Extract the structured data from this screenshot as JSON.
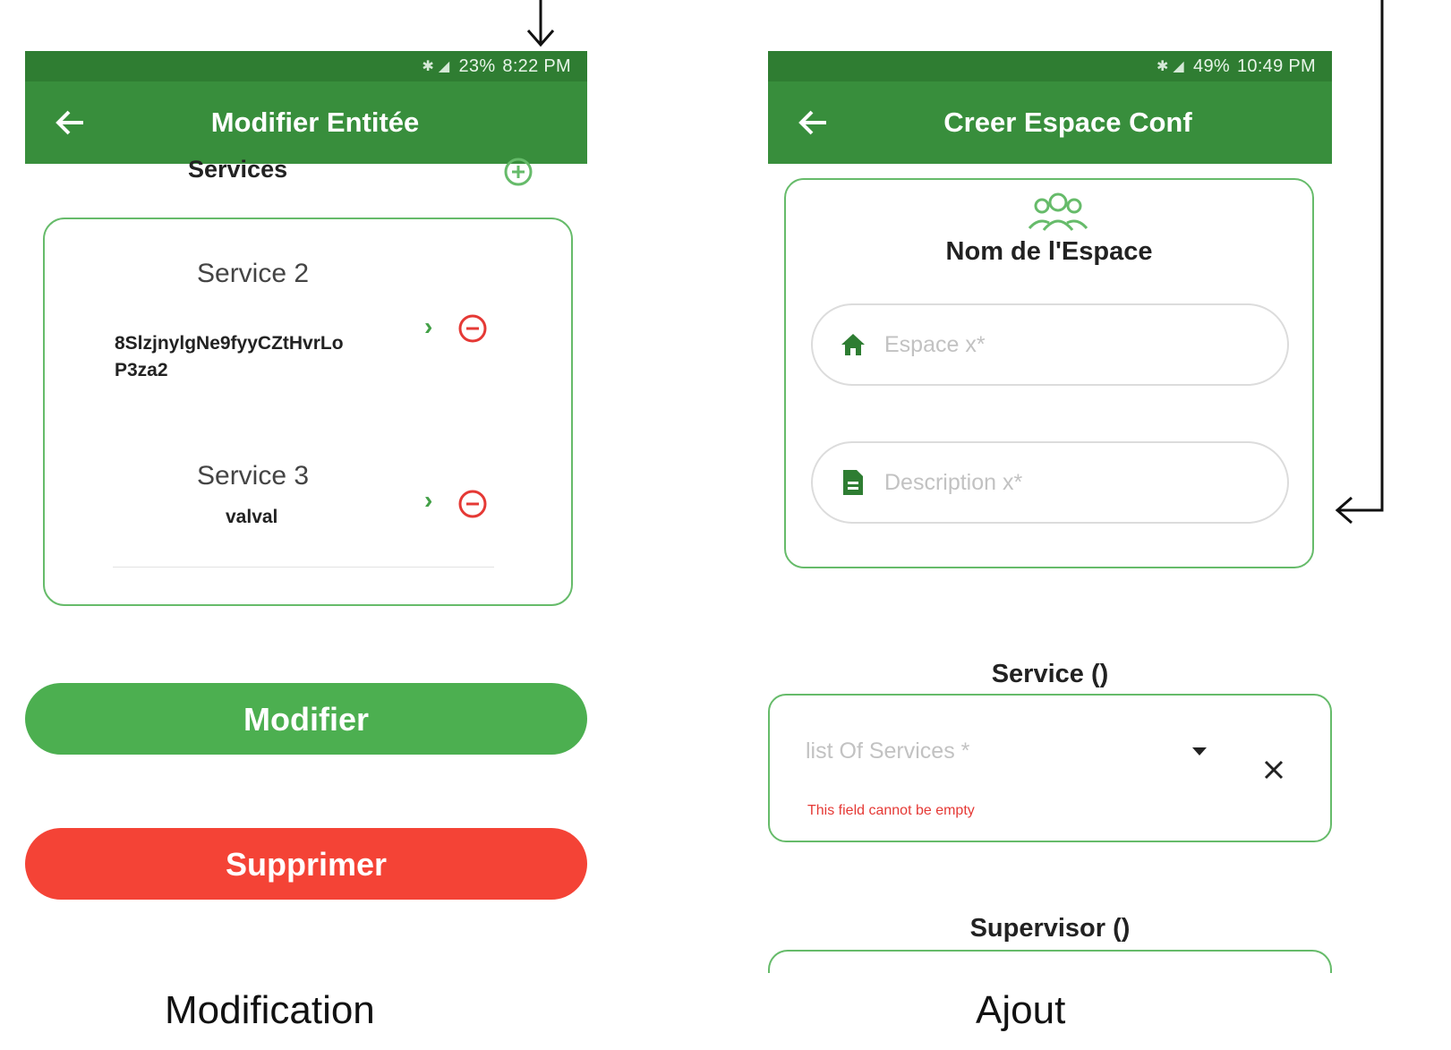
{
  "left_screen": {
    "status": {
      "icons": "✱ ◢",
      "battery": "23%",
      "time": "8:22 PM"
    },
    "title": "Modifier Entitée",
    "services_label": "Services",
    "services": [
      {
        "name": "Service 2",
        "value_line1": "8SlzjnylgNe9fyyCZtHvrLo",
        "value_line2": "P3za2"
      },
      {
        "name": "Service 3",
        "value_line1": "valval",
        "value_line2": ""
      }
    ],
    "modify_label": "Modifier",
    "delete_label": "Supprimer",
    "caption": "Modification"
  },
  "right_screen": {
    "status": {
      "icons": "✱ ◢",
      "battery": "49%",
      "time": "10:49 PM"
    },
    "title": "Creer Espace Conf",
    "espace_heading": "Nom de l'Espace",
    "espace_placeholder": "Espace x*",
    "description_placeholder": "Description x*",
    "service_label": "Service ()",
    "services_placeholder": "list Of Services *",
    "error_message": "This field cannot be empty",
    "supervisor_label": "Supervisor ()",
    "caption": "Ajout"
  },
  "colors": {
    "status_bar": "#2f7d32",
    "app_bar": "#388e3c",
    "accent_green": "#4caf50",
    "danger_red": "#f44336",
    "card_border": "#66bb6a"
  },
  "icons": [
    "back-arrow-icon",
    "add-circle-icon",
    "chevron-right-icon",
    "remove-circle-icon",
    "people-icon",
    "home-icon",
    "document-icon",
    "dropdown-arrow-icon",
    "close-icon"
  ]
}
